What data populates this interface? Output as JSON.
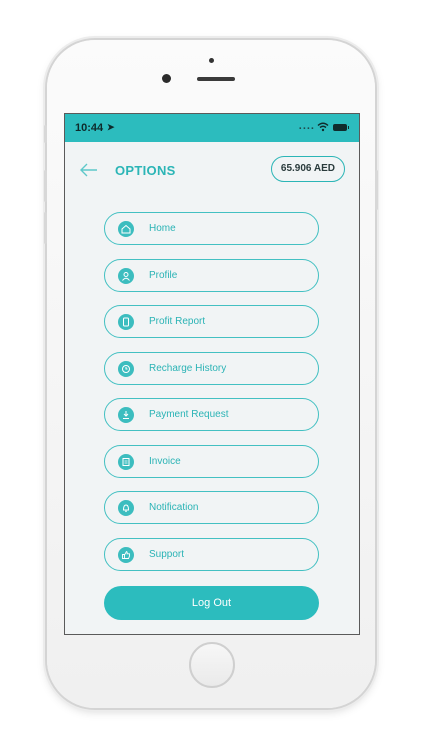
{
  "status": {
    "time": "10:44",
    "dots": "...."
  },
  "header": {
    "title": "OPTIONS",
    "balance": "65.906 AED"
  },
  "menu": {
    "items": [
      {
        "label": "Home",
        "icon": "home-icon"
      },
      {
        "label": "Profile",
        "icon": "user-icon"
      },
      {
        "label": "Profit Report",
        "icon": "report-icon"
      },
      {
        "label": "Recharge History",
        "icon": "history-icon"
      },
      {
        "label": "Payment Request",
        "icon": "payment-icon"
      },
      {
        "label": "Invoice",
        "icon": "invoice-icon"
      },
      {
        "label": "Notification",
        "icon": "bell-icon"
      },
      {
        "label": "Support",
        "icon": "support-icon"
      }
    ]
  },
  "logout": {
    "label": "Log Out"
  },
  "colors": {
    "accent": "#2cbcbe",
    "screen_bg": "#f1f4f5"
  }
}
